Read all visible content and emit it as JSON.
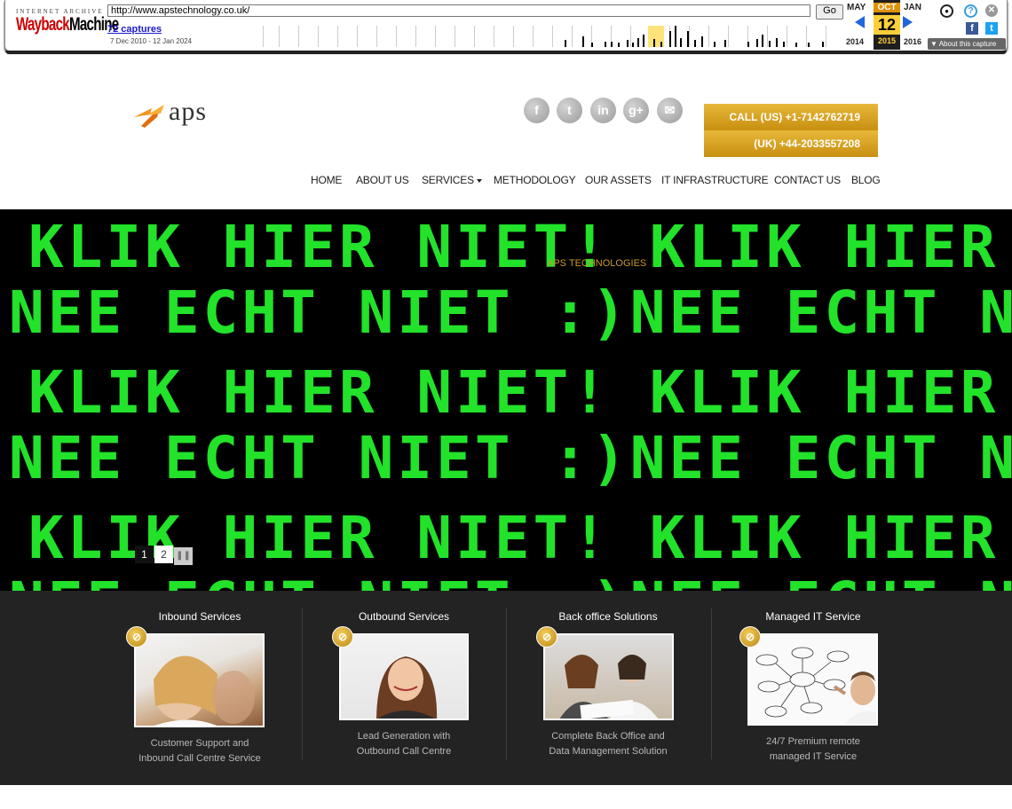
{
  "wayback": {
    "logo_top": "INTERNET ARCHIVE",
    "logo_prefix": "Wayback",
    "logo_suffix": "Machine",
    "url": "http://www.apstechnology.co.uk/",
    "go_label": "Go",
    "captures": "72 captures",
    "range": "7 Dec 2010 - 12 Jan 2024",
    "prev_month": "MAY",
    "cur_month": "OCT",
    "next_month": "JAN",
    "cur_day": "12",
    "prev_year": "2014",
    "cur_year": "2015",
    "next_year": "2016",
    "about": "About this capture",
    "colors": {
      "highlight": "#ffcf3a",
      "accent": "#2266dd"
    }
  },
  "header": {
    "logo_text": "aps",
    "social_icons": [
      "facebook-icon",
      "twitter-icon",
      "linkedin-icon",
      "googleplus-icon",
      "email-icon"
    ],
    "social_glyphs": [
      "f",
      "t",
      "in",
      "g+",
      "✉"
    ],
    "call_us": "CALL (US) +1-7142762719",
    "call_uk": "(UK) +44-2033557208",
    "accent_color": "#d9a21f"
  },
  "nav": {
    "items": [
      "HOME",
      "ABOUT US",
      "SERVICES",
      "METHODOLOGY",
      "OUR ASSETS",
      "IT INFRASTRUCTURE",
      "CONTACT US",
      "BLOG"
    ]
  },
  "hero": {
    "line_a": "KLIK HIER NIET! KLIK HIER",
    "line_b": "NEE ECHT NIET :)NEE ECHT N",
    "caption": "APS TECHNOLOGIES",
    "slides": [
      "1",
      "2"
    ],
    "pause_icon": "pause-icon",
    "text_color": "#22e22a"
  },
  "services": [
    {
      "title": "Inbound Services",
      "desc_1": "Customer Support and",
      "desc_2": "Inbound Call Centre Service"
    },
    {
      "title": "Outbound Services",
      "desc_1": "Lead Generation with",
      "desc_2": "Outbound Call Centre"
    },
    {
      "title": "Back office Solutions",
      "desc_1": "Complete Back Office and",
      "desc_2": "Data Management Solution"
    },
    {
      "title": "Managed IT Service",
      "desc_1": "24/7 Premium remote",
      "desc_2": "managed IT Service"
    }
  ]
}
